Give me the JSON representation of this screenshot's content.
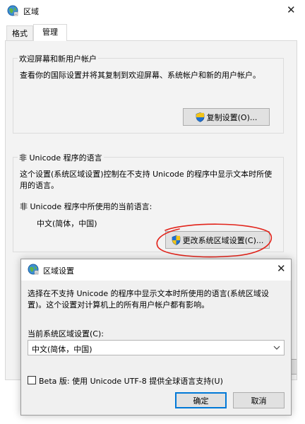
{
  "main_window": {
    "title": "区域",
    "tabs": [
      {
        "label": "格式"
      },
      {
        "label": "管理"
      }
    ],
    "welcome": {
      "title": "欢迎屏幕和新用户帐户",
      "description": "查看你的国际设置并将其复制到欢迎屏幕、系统帐户和新的用户帐户。",
      "copy_button": "复制设置(O)..."
    },
    "nonunicode": {
      "title": "非 Unicode 程序的语言",
      "description": "这个设置(系统区域设置)控制在不支持 Unicode 的程序中显示文本时所使用的语言。",
      "current_label": "非 Unicode 程序中所使用的当前语言:",
      "current_value": "中文(简体，中国)",
      "change_button": "更改系统区域设置(C)..."
    }
  },
  "dialog": {
    "title": "区域设置",
    "description": "选择在不支持 Unicode 的程序中显示文本时所使用的语言(系统区域设置)。这个设置对计算机上的所有用户帐户都有影响。",
    "current_label": "当前系统区域设置(C):",
    "current_value": "中文(简体，中国)",
    "beta_checkbox": {
      "label": "Beta 版: 使用 Unicode UTF-8 提供全球语言支持(U)",
      "checked": false
    },
    "ok_button": "确定",
    "cancel_button": "取消"
  },
  "annotation": {
    "color": "#e2231a"
  },
  "icons": {
    "app": "globe-region-icon",
    "shield": "uac-shield-icon",
    "close": "close-icon",
    "dropdown": "chevron-down-icon"
  }
}
